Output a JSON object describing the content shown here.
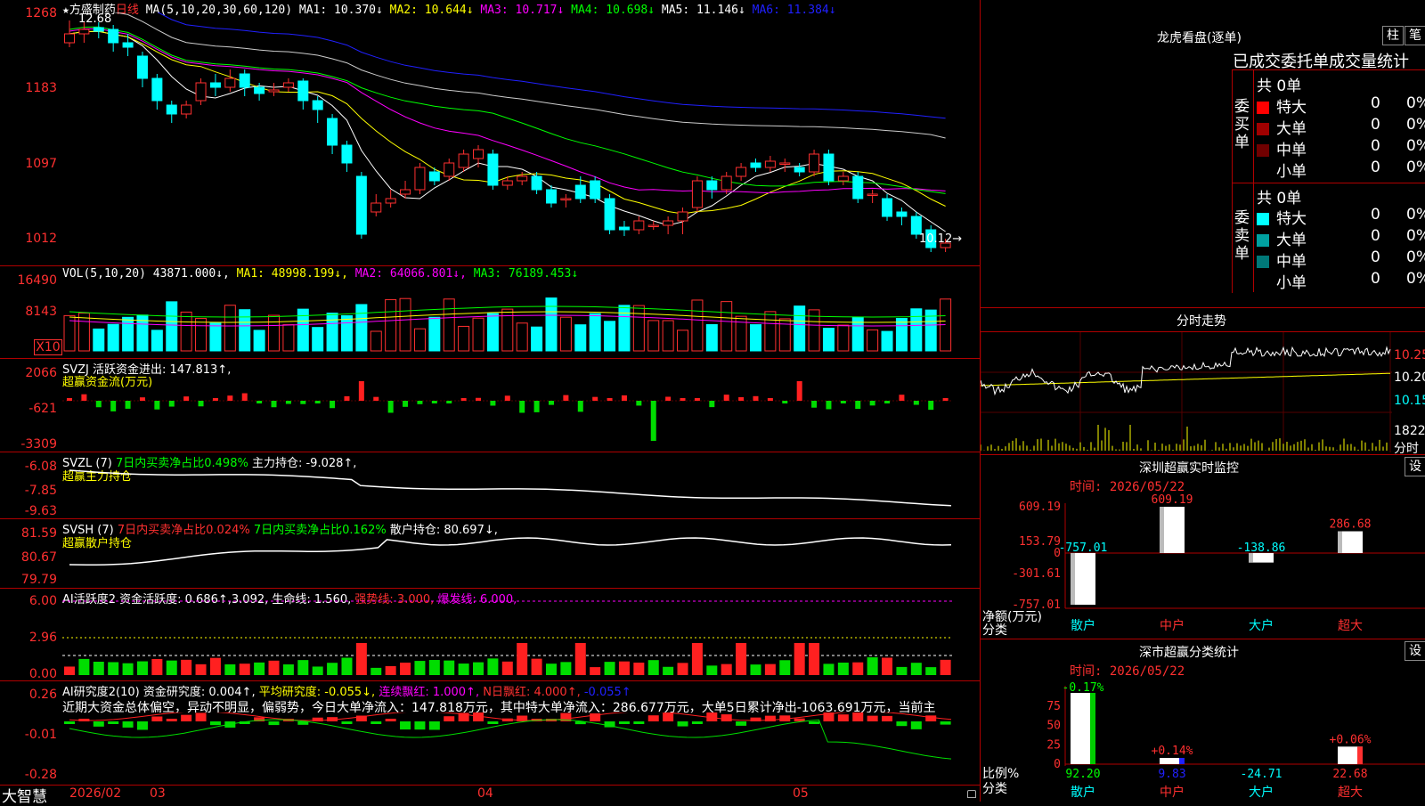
{
  "stock": {
    "star": "★",
    "name": "方盛制药",
    "period": "日线",
    "ma_params": "MA(5,10,20,30,60,120)"
  },
  "kline": {
    "ma_values": [
      {
        "label": "MA1: 10.370↓",
        "color": "#ffffff"
      },
      {
        "label": "MA2: 10.644↓",
        "color": "#ffff00"
      },
      {
        "label": "MA3: 10.717↓",
        "color": "#ff00ff"
      },
      {
        "label": "MA4: 10.698↓",
        "color": "#00ff00"
      },
      {
        "label": "MA5: 11.146↓",
        "color": "#ffffff"
      },
      {
        "label": "MA6: 11.384↓",
        "color": "#2020ff"
      }
    ],
    "yticks": [
      "1268",
      "1183",
      "1097",
      "1012"
    ],
    "high_label": "12.68",
    "last_label": "10.12→",
    "candles": [
      [
        12.45,
        12.55,
        12.7,
        12.4
      ],
      [
        12.55,
        12.6,
        12.68,
        12.45
      ],
      [
        12.62,
        12.58,
        12.68,
        12.5
      ],
      [
        12.6,
        12.45,
        12.65,
        12.35
      ],
      [
        12.45,
        12.4,
        12.55,
        12.3
      ],
      [
        12.3,
        12.05,
        12.35,
        11.95
      ],
      [
        12.05,
        11.8,
        12.1,
        11.7
      ],
      [
        11.75,
        11.65,
        11.8,
        11.55
      ],
      [
        11.65,
        11.75,
        11.8,
        11.6
      ],
      [
        11.8,
        12.0,
        12.05,
        11.75
      ],
      [
        12.0,
        11.95,
        12.1,
        11.85
      ],
      [
        11.95,
        12.05,
        12.15,
        11.9
      ],
      [
        12.1,
        11.95,
        12.15,
        11.85
      ],
      [
        11.95,
        11.88,
        12.0,
        11.8
      ],
      [
        11.9,
        11.92,
        12.0,
        11.85
      ],
      [
        11.95,
        12.0,
        12.05,
        11.9
      ],
      [
        12.02,
        11.8,
        12.05,
        11.7
      ],
      [
        11.8,
        11.7,
        11.85,
        11.55
      ],
      [
        11.6,
        11.3,
        11.65,
        11.2
      ],
      [
        11.3,
        11.1,
        11.35,
        11.0
      ],
      [
        10.95,
        10.3,
        11.0,
        10.25
      ],
      [
        10.55,
        10.65,
        10.75,
        10.5
      ],
      [
        10.65,
        10.7,
        10.8,
        10.6
      ],
      [
        10.75,
        10.8,
        10.9,
        10.7
      ],
      [
        10.8,
        11.05,
        11.1,
        10.75
      ],
      [
        11.0,
        10.9,
        11.05,
        10.85
      ],
      [
        10.95,
        11.1,
        11.15,
        10.9
      ],
      [
        11.05,
        11.2,
        11.25,
        11.0
      ],
      [
        11.15,
        11.25,
        11.3,
        11.05
      ],
      [
        11.2,
        10.85,
        11.25,
        10.8
      ],
      [
        10.85,
        10.9,
        10.95,
        10.8
      ],
      [
        10.9,
        10.95,
        11.0,
        10.85
      ],
      [
        10.95,
        10.8,
        11.0,
        10.75
      ],
      [
        10.8,
        10.65,
        10.85,
        10.6
      ],
      [
        10.7,
        10.7,
        10.75,
        10.6
      ],
      [
        10.85,
        10.7,
        10.95,
        10.65
      ],
      [
        10.9,
        10.7,
        10.95,
        10.65
      ],
      [
        10.7,
        10.35,
        10.75,
        10.3
      ],
      [
        10.38,
        10.35,
        10.45,
        10.28
      ],
      [
        10.35,
        10.45,
        10.5,
        10.3
      ],
      [
        10.4,
        10.4,
        10.45,
        10.35
      ],
      [
        10.4,
        10.45,
        10.5,
        10.3
      ],
      [
        10.45,
        10.55,
        10.6,
        10.3
      ],
      [
        10.6,
        10.9,
        10.95,
        10.55
      ],
      [
        10.9,
        10.8,
        10.95,
        10.7
      ],
      [
        10.8,
        10.95,
        11.0,
        10.75
      ],
      [
        10.95,
        11.05,
        11.1,
        10.9
      ],
      [
        11.1,
        11.05,
        11.15,
        11.0
      ],
      [
        11.05,
        11.12,
        11.18,
        11.0
      ],
      [
        11.1,
        11.1,
        11.15,
        11.0
      ],
      [
        11.05,
        11.0,
        11.1,
        10.95
      ],
      [
        11.0,
        11.2,
        11.25,
        10.95
      ],
      [
        11.2,
        10.9,
        11.25,
        10.85
      ],
      [
        10.9,
        10.95,
        11.0,
        10.85
      ],
      [
        10.95,
        10.7,
        11.0,
        10.65
      ],
      [
        10.75,
        10.75,
        10.8,
        10.65
      ],
      [
        10.7,
        10.5,
        10.75,
        10.45
      ],
      [
        10.55,
        10.5,
        10.6,
        10.4
      ],
      [
        10.5,
        10.3,
        10.55,
        10.25
      ],
      [
        10.35,
        10.15,
        10.4,
        10.1
      ],
      [
        10.15,
        10.2,
        10.25,
        10.1
      ]
    ]
  },
  "vol": {
    "header": "VOL(5,10,20)",
    "value": "43871.000↓,",
    "ma": [
      {
        "label": "MA1: 48998.199↓,",
        "color": "#ffff00"
      },
      {
        "label": "MA2: 64066.801↓,",
        "color": "#ff00ff"
      },
      {
        "label": "MA3: 76189.453↓",
        "color": "#00ff00"
      }
    ],
    "yticks": [
      "16490",
      "8143"
    ],
    "unit_label": "X10"
  },
  "svzj": {
    "header_name": "SVZJ",
    "header_main": "活跃资金进出: 147.813↑,",
    "sub": "超赢资金流(万元)",
    "yticks": [
      "2066",
      "-621",
      "-3309"
    ]
  },
  "svzl": {
    "header_name": "SVZL (7)",
    "header_a": "7日内买卖净占比0.498%",
    "header_b": "主力持仓: -9.028↑,",
    "sub": "超赢主力持仓",
    "yticks": [
      "-6.08",
      "-7.85",
      "-9.63"
    ]
  },
  "svsh": {
    "header_name": "SVSH (7)",
    "header_a": "7日内买卖净占比0.024%",
    "header_b": "7日内买卖净占比0.162%",
    "header_c": "散户持仓: 80.697↓,",
    "sub": "超赢散户持仓",
    "yticks": [
      "81.59",
      "80.67",
      "79.79"
    ]
  },
  "ai_active": {
    "header_name": "AI活跃度2",
    "header_a": "资金活跃度: 0.686↑,3.092,",
    "header_b": "生命线: 1.560,",
    "header_c": "强势线: 3.000,",
    "header_d": "爆发线: 6.000,",
    "yticks": [
      "6.00",
      "2.96",
      "0.00"
    ]
  },
  "ai_research": {
    "header_name": "AI研究度2(10)",
    "header_a": "资金研究度: 0.004↑,",
    "header_b": "平均研究度: -0.055↓,",
    "header_c": "连续飘红: 1.000↑,",
    "header_d": "N日飘红: 4.000↑,",
    "header_e": "-0.055↑",
    "comment": "近期大资金总体偏空，异动不明显，偏弱势，今日大单净流入：147.818万元，其中特大单净流入：286.677万元，大单5日累计净出-1063.691万元，当前主",
    "yticks": [
      "0.26",
      "-0.01",
      "-0.28"
    ]
  },
  "footer": {
    "brand": "大智慧",
    "date_start": "2026/02",
    "months": [
      "03",
      "04",
      "05"
    ]
  },
  "lhb": {
    "title": "龙虎看盘(逐单)",
    "btn1": "柱",
    "btn2": "笔",
    "tabs_text": "已成交委托单成交量统计",
    "buy_label": "委买单",
    "sell_label": "委卖单",
    "buy_total": "共 0单",
    "sell_total": "共 0单",
    "buy_rows": [
      {
        "name": "特大",
        "val": "0",
        "pct": "0%",
        "color": "#ff0000"
      },
      {
        "name": "大单",
        "val": "0",
        "pct": "0%",
        "color": "#a00000"
      },
      {
        "name": "中单",
        "val": "0",
        "pct": "0%",
        "color": "#700000"
      },
      {
        "name": "小单",
        "val": "0",
        "pct": "0%",
        "color": ""
      }
    ],
    "sell_rows": [
      {
        "name": "特大",
        "val": "0",
        "pct": "0%",
        "color": "#00ffff"
      },
      {
        "name": "大单",
        "val": "0",
        "pct": "0%",
        "color": "#00a0a0"
      },
      {
        "name": "中单",
        "val": "0",
        "pct": "0%",
        "color": "#007878"
      },
      {
        "name": "小单",
        "val": "0",
        "pct": "0%",
        "color": ""
      }
    ]
  },
  "intraday": {
    "title": "分时走势",
    "yticks": [
      "10.25",
      "10.20",
      "10.15"
    ],
    "vol_label": "1822",
    "vol_unit": "分时"
  },
  "sz_monitor": {
    "title": "深圳超赢实时监控",
    "btn": "设",
    "time_label": "时间: 2026/05/22",
    "yticks": [
      "609.19",
      "153.79",
      "0",
      "-301.61",
      "-757.01"
    ],
    "axis_name_1": "净额(万元)",
    "axis_name_2": "分类",
    "categories": [
      "散户",
      "中户",
      "大户",
      "超大"
    ],
    "values": [
      -757.01,
      609.19,
      -138.86,
      286.68
    ],
    "value_labels": [
      "-757.01",
      "609.19",
      "-138.86",
      "286.68"
    ]
  },
  "sz_class": {
    "title": "深市超赢分类统计",
    "btn": "设",
    "time_label": "时间: 2026/05/22",
    "yticks": [
      "75",
      "50",
      "25",
      "0"
    ],
    "axis_name_1": "比例%",
    "axis_name_2": "分类",
    "categories": [
      "散户",
      "中户",
      "大户",
      "超大"
    ],
    "top_labels": [
      "-0.17%",
      "+0.14%",
      "",
      "+0.06%"
    ],
    "bottom_labels": [
      "92.20",
      "9.83",
      "-24.71",
      "22.68"
    ],
    "values": [
      92.2,
      9.83,
      -24.71,
      22.68
    ]
  }
}
